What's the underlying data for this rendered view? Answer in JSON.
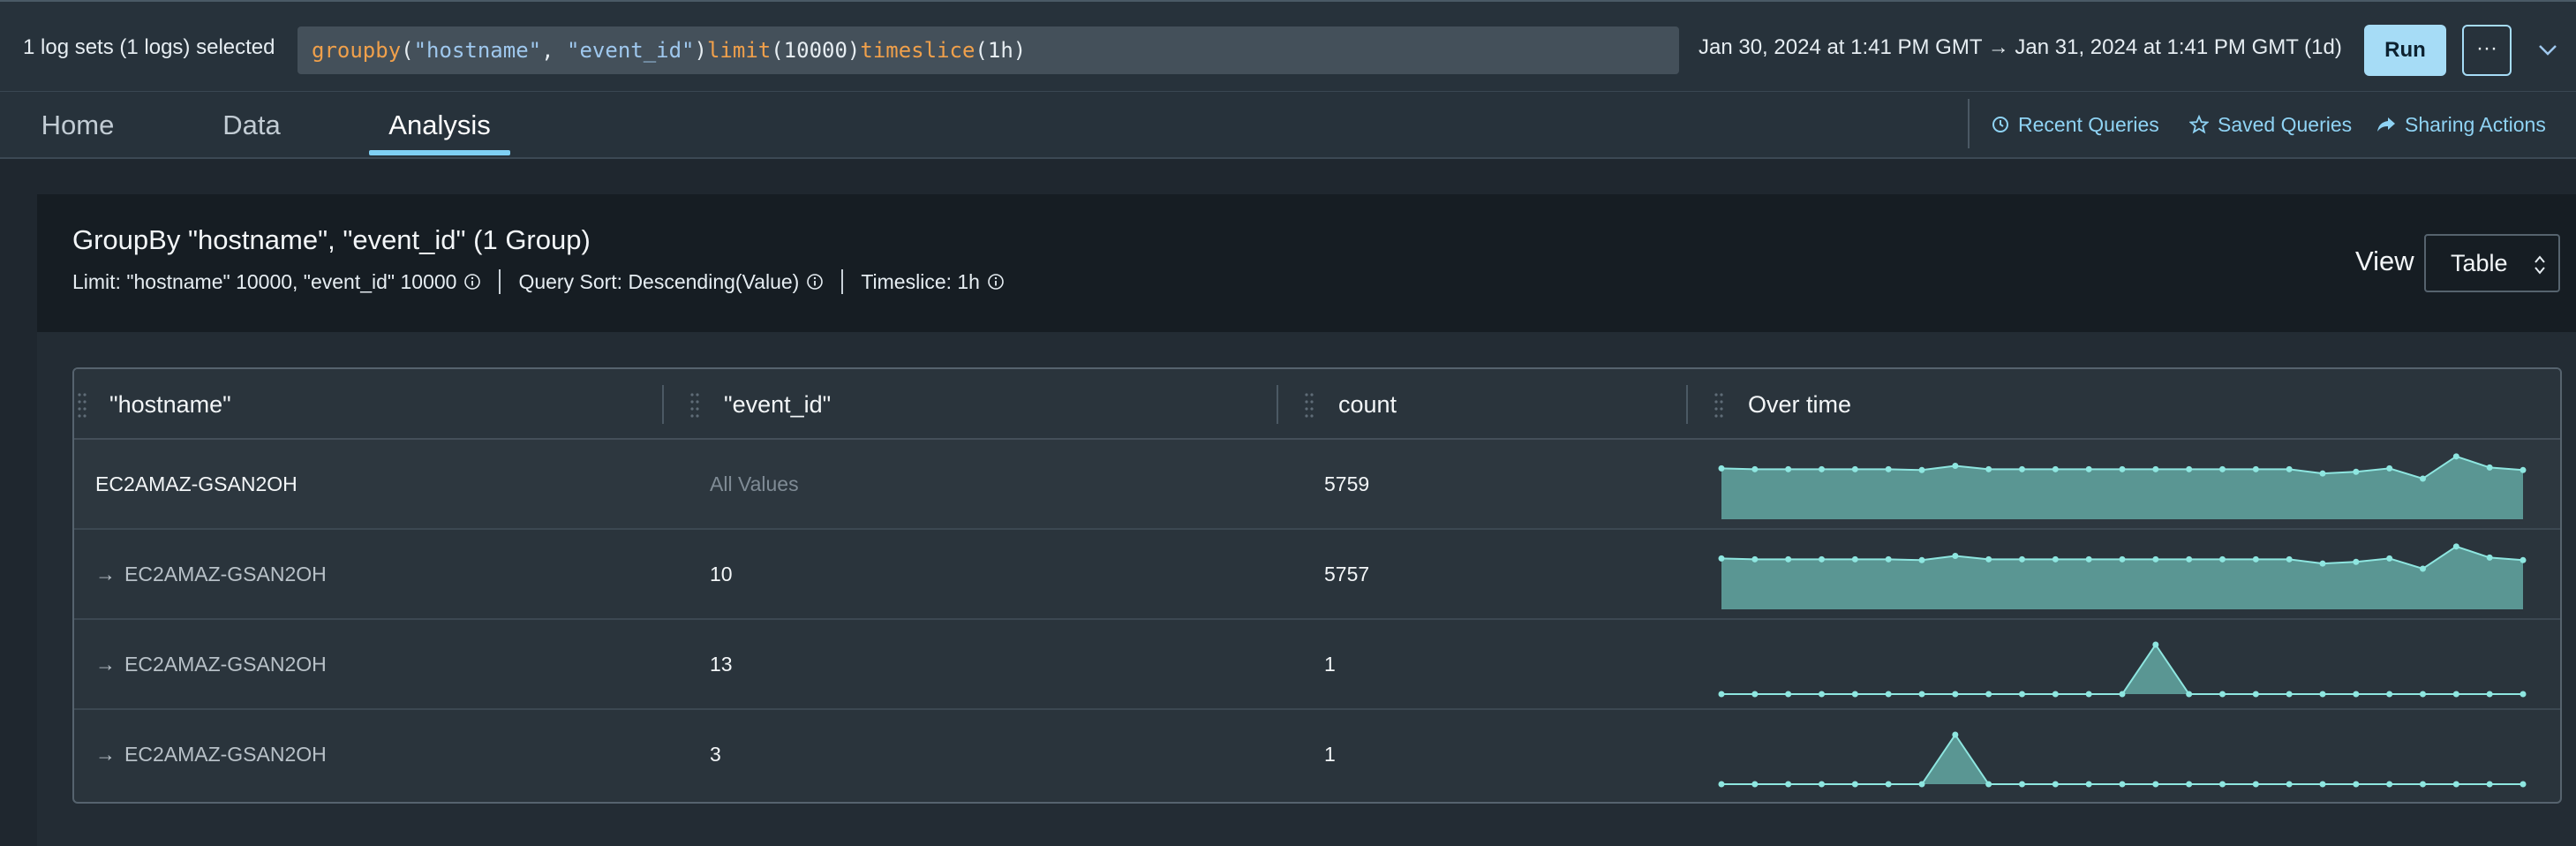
{
  "topbar": {
    "log_sets": "1 log sets (1 logs) selected",
    "query_tokens": [
      {
        "t": "groupby",
        "k": "fn"
      },
      {
        "t": "(",
        "k": "plain"
      },
      {
        "t": "\"hostname\"",
        "k": "str"
      },
      {
        "t": ", ",
        "k": "plain"
      },
      {
        "t": "\"event_id\"",
        "k": "str"
      },
      {
        "t": ")",
        "k": "plain"
      },
      {
        "t": "limit",
        "k": "fn"
      },
      {
        "t": "(10000)",
        "k": "plain"
      },
      {
        "t": "timeslice",
        "k": "fn"
      },
      {
        "t": "(1h)",
        "k": "plain"
      }
    ],
    "time_range": "Jan 30, 2024 at 1:41 PM GMT → Jan 31, 2024 at 1:41 PM GMT (1d)",
    "run_label": "Run",
    "more_label": "···",
    "collapse_icon": "chevron-down-icon"
  },
  "tabs": [
    {
      "label": "Home",
      "active": false
    },
    {
      "label": "Data",
      "active": false
    },
    {
      "label": "Analysis",
      "active": true
    }
  ],
  "actions": {
    "recent": "Recent Queries",
    "saved": "Saved Queries",
    "sharing": "Sharing Actions"
  },
  "panel": {
    "title": "GroupBy \"hostname\", \"event_id\" (1 Group)",
    "limit_text": "Limit: \"hostname\" 10000, \"event_id\" 10000",
    "sort_text": "Query Sort: Descending(Value)",
    "timeslice_text": "Timeslice: 1h",
    "view_label": "View",
    "view_value": "Table"
  },
  "table": {
    "headers": [
      "\"hostname\"",
      "\"event_id\"",
      "count",
      "Over time"
    ],
    "rows": [
      {
        "hostname": "EC2AMAZ-GSAN2OH",
        "event_id": "All Values",
        "count": "5759",
        "child": false,
        "series": [
          241,
          240,
          240,
          240,
          240,
          240,
          239,
          244,
          240,
          240,
          240,
          240,
          240,
          240,
          240,
          240,
          240,
          240,
          235,
          237,
          241,
          229,
          255,
          242,
          239
        ]
      },
      {
        "hostname": "EC2AMAZ-GSAN2OH",
        "event_id": "10",
        "count": "5757",
        "child": true,
        "series": [
          241,
          240,
          240,
          240,
          240,
          240,
          239,
          244,
          240,
          240,
          240,
          240,
          240,
          240,
          240,
          240,
          240,
          240,
          235,
          237,
          241,
          229,
          255,
          242,
          239
        ]
      },
      {
        "hostname": "EC2AMAZ-GSAN2OH",
        "event_id": "13",
        "count": "1",
        "child": true,
        "series": [
          0,
          0,
          0,
          0,
          0,
          0,
          0,
          0,
          0,
          0,
          0,
          0,
          0,
          1,
          0,
          0,
          0,
          0,
          0,
          0,
          0,
          0,
          0,
          0,
          0
        ]
      },
      {
        "hostname": "EC2AMAZ-GSAN2OH",
        "event_id": "3",
        "count": "1",
        "child": true,
        "series": [
          0,
          0,
          0,
          0,
          0,
          0,
          0,
          1,
          0,
          0,
          0,
          0,
          0,
          0,
          0,
          0,
          0,
          0,
          0,
          0,
          0,
          0,
          0,
          0,
          0
        ]
      }
    ]
  },
  "colors": {
    "accent": "#a6dcf6",
    "spark_line": "#8ee6e0",
    "spark_fill": "#5a9693",
    "query_fn": "#f0a04b",
    "query_str": "#9fc8ee"
  }
}
